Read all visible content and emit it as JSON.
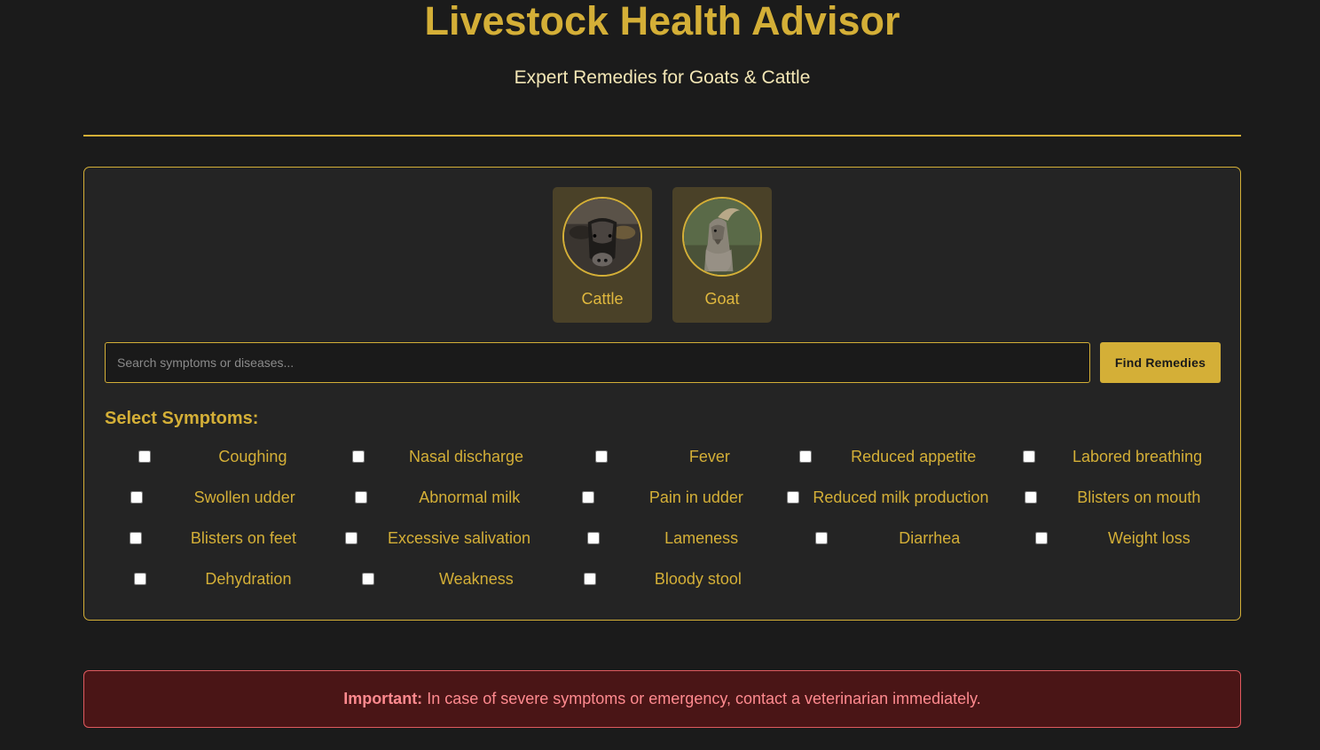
{
  "header": {
    "title": "Livestock Health Advisor",
    "subtitle": "Expert Remedies for Goats & Cattle"
  },
  "animals": [
    {
      "label": "Cattle",
      "icon": "cattle-photo"
    },
    {
      "label": "Goat",
      "icon": "goat-photo"
    }
  ],
  "search": {
    "placeholder": "Search symptoms or diseases...",
    "value": "",
    "button_label": "Find Remedies"
  },
  "symptoms": {
    "heading": "Select Symptoms:",
    "items": [
      {
        "label": "Coughing",
        "checked": false
      },
      {
        "label": "Nasal discharge",
        "checked": false
      },
      {
        "label": "Fever",
        "checked": false
      },
      {
        "label": "Reduced appetite",
        "checked": false
      },
      {
        "label": "Labored breathing",
        "checked": false
      },
      {
        "label": "Swollen udder",
        "checked": false
      },
      {
        "label": "Abnormal milk",
        "checked": false
      },
      {
        "label": "Pain in udder",
        "checked": false
      },
      {
        "label": "Reduced milk production",
        "checked": false
      },
      {
        "label": "Blisters on mouth",
        "checked": false
      },
      {
        "label": "Blisters on feet",
        "checked": false
      },
      {
        "label": "Excessive salivation",
        "checked": false
      },
      {
        "label": "Lameness",
        "checked": false
      },
      {
        "label": "Diarrhea",
        "checked": false
      },
      {
        "label": "Weight loss",
        "checked": false
      },
      {
        "label": "Dehydration",
        "checked": false
      },
      {
        "label": "Weakness",
        "checked": false
      },
      {
        "label": "Bloody stool",
        "checked": false
      }
    ]
  },
  "warning": {
    "label": "Important:",
    "text": "In case of severe symptoms or emergency, contact a veterinarian immediately."
  },
  "colors": {
    "accent": "#d4af37",
    "background": "#1b1b1b",
    "panel": "#242424",
    "warning_bg": "#4a1516",
    "warning_text": "#ff8a8f"
  }
}
